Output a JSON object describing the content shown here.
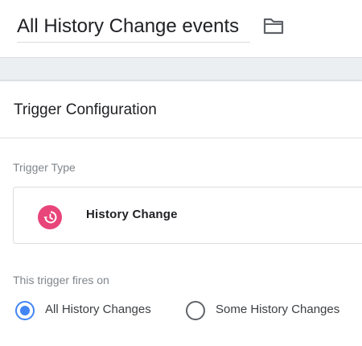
{
  "header": {
    "title": "All History Change events",
    "folder_icon": "folder-icon"
  },
  "card": {
    "title": "Trigger Configuration",
    "trigger_type_label": "Trigger Type",
    "trigger_type": {
      "name": "History Change",
      "icon": "history-icon",
      "icon_color": "#e8457a"
    },
    "fires_on_label": "This trigger fires on",
    "options": [
      {
        "label": "All History Changes",
        "selected": true
      },
      {
        "label": "Some History Changes",
        "selected": false
      }
    ]
  },
  "colors": {
    "accent": "#4285f4",
    "background_band": "#eceff1"
  }
}
